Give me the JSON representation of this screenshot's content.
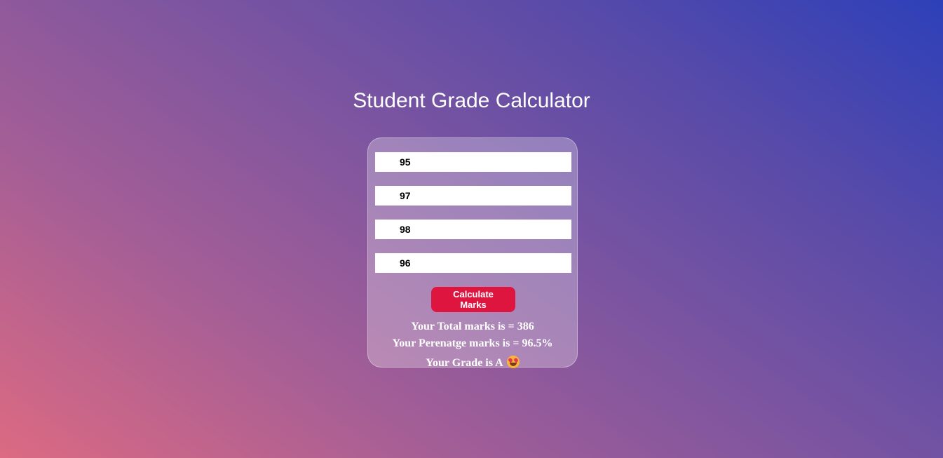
{
  "page": {
    "title": "Student Grade Calculator"
  },
  "form": {
    "inputs": [
      {
        "value": "95"
      },
      {
        "value": "97"
      },
      {
        "value": "98"
      },
      {
        "value": "96"
      }
    ],
    "button_label": "Calculate Marks"
  },
  "results": {
    "total_text": "Your Total marks is = 386",
    "percentage_text": "Your Perenatge marks is = 96.5%",
    "grade_text": "Your Grade is A",
    "grade_emoji_icon": "smiling-face-with-hearts-icon"
  },
  "colors": {
    "button": "#de153f",
    "gradient_start": "#dc6a82",
    "gradient_end": "#2d40b9"
  }
}
